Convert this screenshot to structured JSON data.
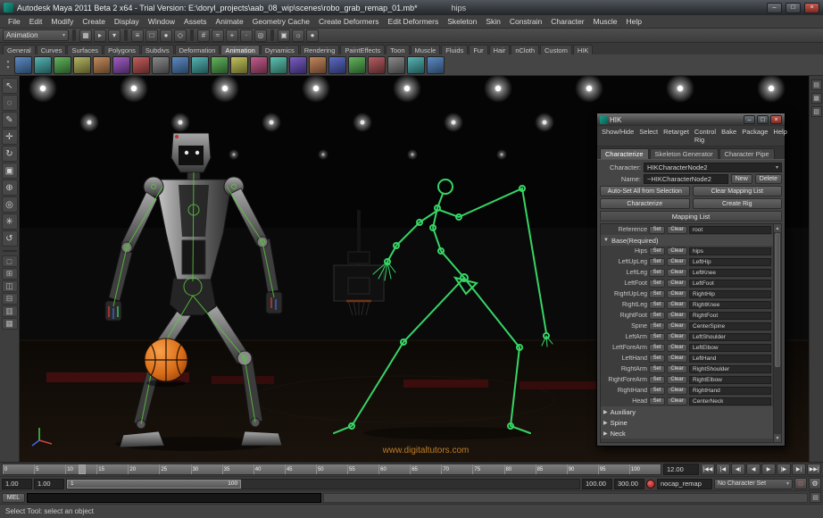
{
  "titlebar": {
    "title": "Autodesk Maya 2011 Beta 2 x64 - Trial Version: E:\\doryl_projects\\aab_08_wip\\scenes\\robo_grab_remap_01.mb*",
    "subtitle": "hips"
  },
  "window_buttons": {
    "minimize": "–",
    "maximize": "□",
    "close": "×"
  },
  "glyphs": {
    "dropdown": "▾",
    "tri_open": "▼",
    "tri_closed": "▶",
    "scroll_up": "▲",
    "scroll_down": "▼"
  },
  "menubar": {
    "items": [
      "File",
      "Edit",
      "Modify",
      "Create",
      "Display",
      "Window",
      "Assets",
      "Animate",
      "Geometry Cache",
      "Create Deformers",
      "Edit Deformers",
      "Skeleton",
      "Skin",
      "Constrain",
      "Character",
      "Muscle",
      "Help"
    ]
  },
  "statusline": {
    "menuset": "Animation",
    "groups": [
      {
        "name": "file-group",
        "icons": [
          {
            "name": "new-scene-icon",
            "glyph": "▦"
          },
          {
            "name": "open-scene-icon",
            "glyph": "▸"
          },
          {
            "name": "save-scene-icon",
            "glyph": "▾"
          }
        ]
      },
      {
        "name": "selection-mask-group",
        "icons": [
          {
            "name": "select-hierarchy-icon",
            "glyph": "≡"
          },
          {
            "name": "select-object-icon",
            "glyph": "□"
          },
          {
            "name": "select-component-icon",
            "glyph": "●"
          },
          {
            "name": "highlight-selection-icon",
            "glyph": "◇"
          }
        ]
      },
      {
        "name": "snap-group",
        "icons": [
          {
            "name": "snap-grid-icon",
            "glyph": "#"
          },
          {
            "name": "snap-curve-icon",
            "glyph": "≈"
          },
          {
            "name": "snap-point-icon",
            "glyph": "+"
          },
          {
            "name": "snap-view-plane-icon",
            "glyph": "·"
          },
          {
            "name": "snap-surface-icon",
            "glyph": "◎"
          }
        ]
      },
      {
        "name": "render-group",
        "icons": [
          {
            "name": "render-current-frame-icon",
            "glyph": "▣"
          },
          {
            "name": "ipr-render-icon",
            "glyph": "☼"
          },
          {
            "name": "render-settings-icon",
            "glyph": "●"
          }
        ]
      }
    ]
  },
  "shelf": {
    "active_tab": "Animation",
    "tabs": [
      "General",
      "Curves",
      "Surfaces",
      "Polygons",
      "Subdivs",
      "Deformation",
      "Animation",
      "Dynamics",
      "Rendering",
      "PaintEffects",
      "Toon",
      "Muscle",
      "Fluids",
      "Fur",
      "Hair",
      "nCloth",
      "Custom",
      "HIK"
    ],
    "icons": [
      {
        "name": "shelf-icon-1",
        "c1": "#5d8ac2",
        "c2": "#27415f"
      },
      {
        "name": "shelf-icon-2",
        "c1": "#58b3b3",
        "c2": "#1f5252"
      },
      {
        "name": "shelf-icon-3",
        "c1": "#64b45e",
        "c2": "#265426"
      },
      {
        "name": "shelf-icon-4",
        "c1": "#b4b464",
        "c2": "#545426"
      },
      {
        "name": "shelf-icon-5",
        "c1": "#c28a5d",
        "c2": "#5f4127"
      },
      {
        "name": "shelf-icon-6",
        "c1": "#a05dc2",
        "c2": "#47275f"
      },
      {
        "name": "shelf-icon-7",
        "c1": "#c25d5d",
        "c2": "#5f2727"
      },
      {
        "name": "shelf-icon-8",
        "c1": "#8a8a8a",
        "c2": "#3d3d3d"
      },
      {
        "name": "shelf-icon-9",
        "c1": "#5d8ac2",
        "c2": "#27415f"
      },
      {
        "name": "shelf-icon-10",
        "c1": "#58b3b3",
        "c2": "#1f5252"
      },
      {
        "name": "shelf-icon-11",
        "c1": "#64b45e",
        "c2": "#265426"
      },
      {
        "name": "shelf-icon-12",
        "c1": "#c2c25d",
        "c2": "#5f5f27"
      },
      {
        "name": "shelf-icon-13",
        "c1": "#c25d8a",
        "c2": "#5f2741"
      },
      {
        "name": "shelf-icon-14",
        "c1": "#5dc2b3",
        "c2": "#275f52"
      },
      {
        "name": "shelf-icon-15",
        "c1": "#7a5dc2",
        "c2": "#33275f"
      },
      {
        "name": "shelf-icon-16",
        "c1": "#c2875d",
        "c2": "#5f3d27"
      },
      {
        "name": "shelf-icon-17",
        "c1": "#5d6ac2",
        "c2": "#272f5f"
      },
      {
        "name": "shelf-icon-18",
        "c1": "#64b45e",
        "c2": "#265426"
      },
      {
        "name": "shelf-icon-19",
        "c1": "#b45e64",
        "c2": "#542626"
      },
      {
        "name": "shelf-icon-20",
        "c1": "#8a8a8a",
        "c2": "#3d3d3d"
      },
      {
        "name": "shelf-icon-21",
        "c1": "#58b3b3",
        "c2": "#1f5252"
      },
      {
        "name": "shelf-icon-22",
        "c1": "#5d8ac2",
        "c2": "#27415f"
      }
    ]
  },
  "toolbox": {
    "tools": [
      {
        "name": "select-tool",
        "glyph": "↖"
      },
      {
        "name": "lasso-tool",
        "glyph": "◌"
      },
      {
        "name": "paint-select-tool",
        "glyph": "✎"
      },
      {
        "name": "move-tool",
        "glyph": "✛"
      },
      {
        "name": "rotate-tool",
        "glyph": "↻"
      },
      {
        "name": "scale-tool",
        "glyph": "▣"
      },
      {
        "name": "universal-manipulator-tool",
        "glyph": "⊕"
      },
      {
        "name": "soft-modification-tool",
        "glyph": "◎"
      },
      {
        "name": "show-manipulator-tool",
        "glyph": "✳"
      },
      {
        "name": "last-tool",
        "glyph": "↺"
      }
    ],
    "layouts": [
      {
        "name": "layout-single-pane",
        "glyph": "□"
      },
      {
        "name": "layout-four-pane",
        "glyph": "⊞"
      },
      {
        "name": "layout-two-pane-side",
        "glyph": "◫"
      },
      {
        "name": "layout-two-pane-stacked",
        "glyph": "⊟"
      },
      {
        "name": "layout-persp-outliner",
        "glyph": "▥"
      },
      {
        "name": "layout-hypershade",
        "glyph": "▦"
      }
    ]
  },
  "right_strip": {
    "icons": [
      {
        "name": "channel-box-icon",
        "glyph": "▤"
      },
      {
        "name": "layer-editor-icon",
        "glyph": "▦"
      },
      {
        "name": "attribute-editor-icon",
        "glyph": "▧"
      }
    ]
  },
  "viewport": {
    "watermark": "www.digitaltutors.com"
  },
  "hik": {
    "title": "HIK",
    "menus": [
      "Show/Hide",
      "Select",
      "Retarget",
      "Control Rig",
      "Bake",
      "Package",
      "Help"
    ],
    "tabs": [
      "Characterize",
      "Skeleton Generator",
      "Character Pipe"
    ],
    "active_tab": "Characterize",
    "character_label": "Character:",
    "character_value": "HIKCharacterNode2",
    "name_label": "Name:",
    "name_value": "~HIKCharacterNode2",
    "new_button": "New",
    "delete_button": "Delete",
    "auto_set_button": "Auto-Set All from Selection",
    "clear_mapping_button": "Clear Mapping List",
    "characterize_button": "Characterize",
    "create_rig_button": "Create Rig",
    "mapping_list_label": "Mapping List",
    "set_label": "Set",
    "clear_label": "Clear",
    "reference": {
      "label": "Reference",
      "value": "root"
    },
    "base_section_label": "Base(Required)",
    "mapping_rows": [
      {
        "label": "Hips",
        "value": "hips"
      },
      {
        "label": "LeftUpLeg",
        "value": "LeftHip"
      },
      {
        "label": "LeftLeg",
        "value": "LeftKnee"
      },
      {
        "label": "LeftFoot",
        "value": "LeftFoot"
      },
      {
        "label": "RightUpLeg",
        "value": "RightHip"
      },
      {
        "label": "RightLeg",
        "value": "RightKnee"
      },
      {
        "label": "RightFoot",
        "value": "RightFoot"
      },
      {
        "label": "Spine",
        "value": "CenterSpine"
      },
      {
        "label": "LeftArm",
        "value": "LeftShoulder"
      },
      {
        "label": "LeftForeArm",
        "value": "LeftElbow"
      },
      {
        "label": "LeftHand",
        "value": "LeftHand"
      },
      {
        "label": "RightArm",
        "value": "RightShoulder"
      },
      {
        "label": "RightForeArm",
        "value": "RightElbow"
      },
      {
        "label": "RightHand",
        "value": "RightHand"
      },
      {
        "label": "Head",
        "value": "CenterNeck"
      }
    ],
    "collapsed_sections": [
      "Auxiliary",
      "Spine",
      "Neck"
    ]
  },
  "timeslider": {
    "ticks": [
      "0",
      "5",
      "10",
      "15",
      "20",
      "25",
      "30",
      "35",
      "40",
      "45",
      "50",
      "55",
      "60",
      "65",
      "70",
      "75",
      "80",
      "85",
      "90",
      "95",
      "100"
    ],
    "marker_percent": 11.5,
    "current_time": "12.00",
    "playback": [
      {
        "name": "go-to-start-button",
        "glyph": "|◀◀"
      },
      {
        "name": "step-back-key-button",
        "glyph": "|◀"
      },
      {
        "name": "step-back-frame-button",
        "glyph": "◀|"
      },
      {
        "name": "play-backwards-button",
        "glyph": "◀"
      },
      {
        "name": "play-forwards-button",
        "glyph": "▶"
      },
      {
        "name": "step-forward-frame-button",
        "glyph": "|▶"
      },
      {
        "name": "step-forward-key-button",
        "glyph": "▶|"
      },
      {
        "name": "go-to-end-button",
        "glyph": "▶▶|"
      }
    ]
  },
  "rangeslider": {
    "anim_start": "1.00",
    "play_start": "1.00",
    "play_end": "100.00",
    "anim_end": "300.00",
    "range_label_start": "1",
    "range_label_end": "100",
    "clip_name": "nocap_remap",
    "character_set": "No Character Set",
    "autokey_glyph": "⊙",
    "prefs_glyph": "⚙"
  },
  "commandline": {
    "mel_label": "MEL",
    "input_value": "",
    "result_value": "",
    "script_editor_glyph": "▤"
  },
  "helpline": {
    "text": "Select Tool: select an object"
  },
  "colors": {
    "skeleton_green": "#3ae06b",
    "rig_green": "#59c83e",
    "ball_orange": "#d96c18",
    "watermark_orange": "#d9912f"
  }
}
